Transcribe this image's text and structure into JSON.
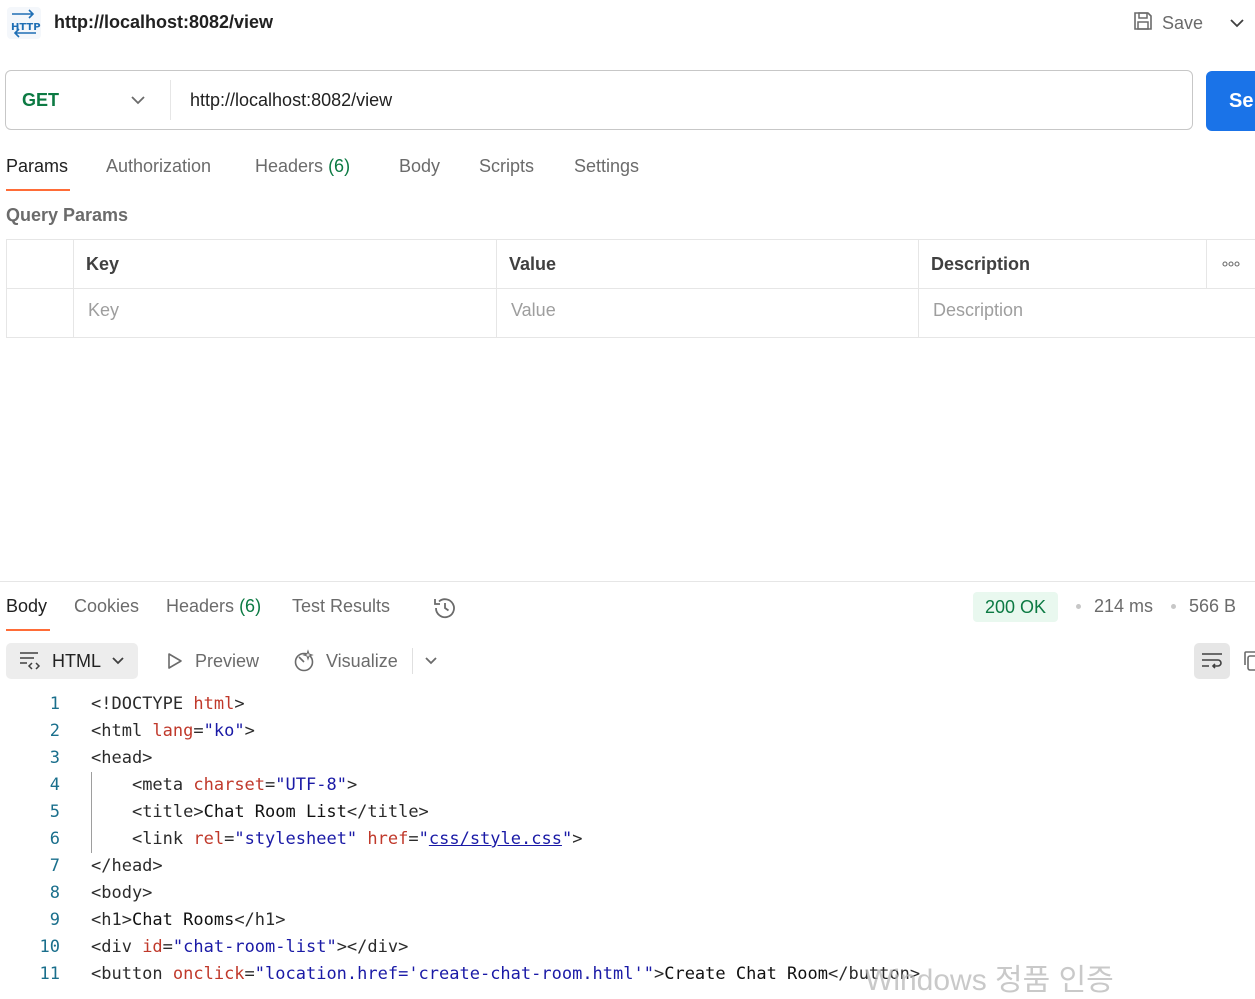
{
  "header": {
    "url_title": "http://localhost:8082/view",
    "save_label": "Save"
  },
  "request": {
    "method": "GET",
    "url": "http://localhost:8082/view",
    "send_label": "Se"
  },
  "request_tabs": [
    {
      "label": "Params"
    },
    {
      "label": "Authorization"
    },
    {
      "label": "Headers",
      "count": "(6)"
    },
    {
      "label": "Body"
    },
    {
      "label": "Scripts"
    },
    {
      "label": "Settings"
    }
  ],
  "query_params": {
    "title": "Query Params",
    "columns": [
      "Key",
      "Value",
      "Description"
    ],
    "placeholders": {
      "key": "Key",
      "value": "Value",
      "description": "Description"
    }
  },
  "response_tabs": [
    {
      "label": "Body"
    },
    {
      "label": "Cookies"
    },
    {
      "label": "Headers",
      "count": "(6)"
    },
    {
      "label": "Test Results"
    }
  ],
  "response_meta": {
    "status": "200 OK",
    "time": "214 ms",
    "size": "566 B"
  },
  "response_toolbar": {
    "format": "HTML",
    "preview": "Preview",
    "visualize": "Visualize"
  },
  "code_lines": [
    {
      "n": "1",
      "tokens": [
        [
          "t",
          "<!DOCTYPE "
        ],
        [
          "a",
          "html"
        ],
        [
          "t",
          ">"
        ]
      ]
    },
    {
      "n": "2",
      "tokens": [
        [
          "t",
          "<html "
        ],
        [
          "a",
          "lang"
        ],
        [
          "t",
          "="
        ],
        [
          "v",
          "\"ko\""
        ],
        [
          "t",
          ">"
        ]
      ]
    },
    {
      "n": "3",
      "tokens": [
        [
          "t",
          "<head>"
        ]
      ]
    },
    {
      "n": "4",
      "tokens": [
        [
          "s",
          "    "
        ],
        [
          "t",
          "<meta "
        ],
        [
          "a",
          "charset"
        ],
        [
          "t",
          "="
        ],
        [
          "v",
          "\"UTF-8\""
        ],
        [
          "t",
          ">"
        ]
      ]
    },
    {
      "n": "5",
      "tokens": [
        [
          "s",
          "    "
        ],
        [
          "t",
          "<title>"
        ],
        [
          "x",
          "Chat Room List"
        ],
        [
          "t",
          "</title>"
        ]
      ]
    },
    {
      "n": "6",
      "tokens": [
        [
          "s",
          "    "
        ],
        [
          "t",
          "<link "
        ],
        [
          "a",
          "rel"
        ],
        [
          "t",
          "="
        ],
        [
          "v",
          "\"stylesheet\""
        ],
        [
          "s",
          " "
        ],
        [
          "a",
          "href"
        ],
        [
          "t",
          "="
        ],
        [
          "v",
          "\""
        ],
        [
          "l",
          "css/style.css"
        ],
        [
          "v",
          "\""
        ],
        [
          "t",
          ">"
        ]
      ]
    },
    {
      "n": "7",
      "tokens": [
        [
          "t",
          "</head>"
        ]
      ]
    },
    {
      "n": "8",
      "tokens": [
        [
          "t",
          "<body>"
        ]
      ]
    },
    {
      "n": "9",
      "tokens": [
        [
          "t",
          "<h1>"
        ],
        [
          "x",
          "Chat Rooms"
        ],
        [
          "t",
          "</h1>"
        ]
      ]
    },
    {
      "n": "10",
      "tokens": [
        [
          "t",
          "<div "
        ],
        [
          "a",
          "id"
        ],
        [
          "t",
          "="
        ],
        [
          "v",
          "\"chat-room-list\""
        ],
        [
          "t",
          "></div>"
        ]
      ]
    },
    {
      "n": "11",
      "tokens": [
        [
          "t",
          "<button "
        ],
        [
          "a",
          "onclick"
        ],
        [
          "t",
          "="
        ],
        [
          "v",
          "\"location.href='create-chat-room.html'\""
        ],
        [
          "t",
          ">"
        ],
        [
          "x",
          "Create Chat Room"
        ],
        [
          "t",
          "</button>"
        ]
      ]
    }
  ],
  "watermark": "Windows 정품 인증",
  "colors": {
    "accent": "#ff6c37",
    "method_get": "#0c7a43",
    "send_blue": "#1a73e8",
    "status_ok_bg": "#e9f8ef"
  },
  "icons": [
    "http-icon",
    "save-icon",
    "chevron-down-icon",
    "more-icon",
    "history-icon",
    "format-icon",
    "play-icon",
    "visualize-icon",
    "wrap-icon",
    "copy-icon"
  ]
}
